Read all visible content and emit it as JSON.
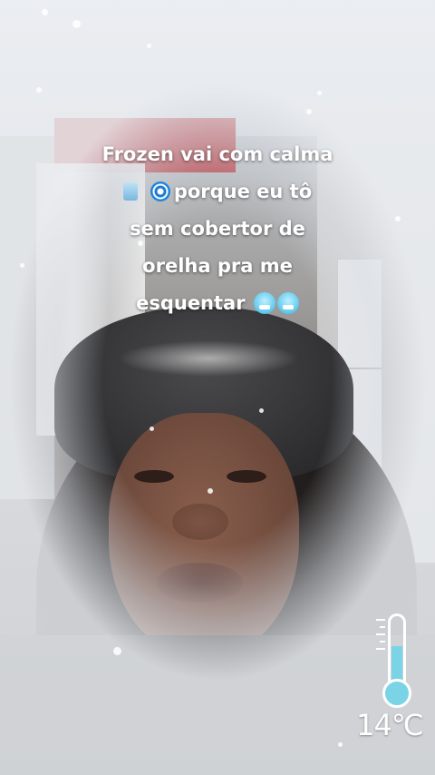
{
  "caption": {
    "line1": "Frozen vai com calma",
    "line2": "porque eu tô",
    "line3": "sem cobertor de",
    "line4": "orelha pra me",
    "line5": "esquentar"
  },
  "icons": {
    "box": "ice-cube-icon",
    "cyclone": "cyclone-icon",
    "cold_face": "cold-face-icon"
  },
  "thermometer": {
    "temperature": "14℃",
    "level": 0.45,
    "fill_color": "#7ad4e6"
  }
}
